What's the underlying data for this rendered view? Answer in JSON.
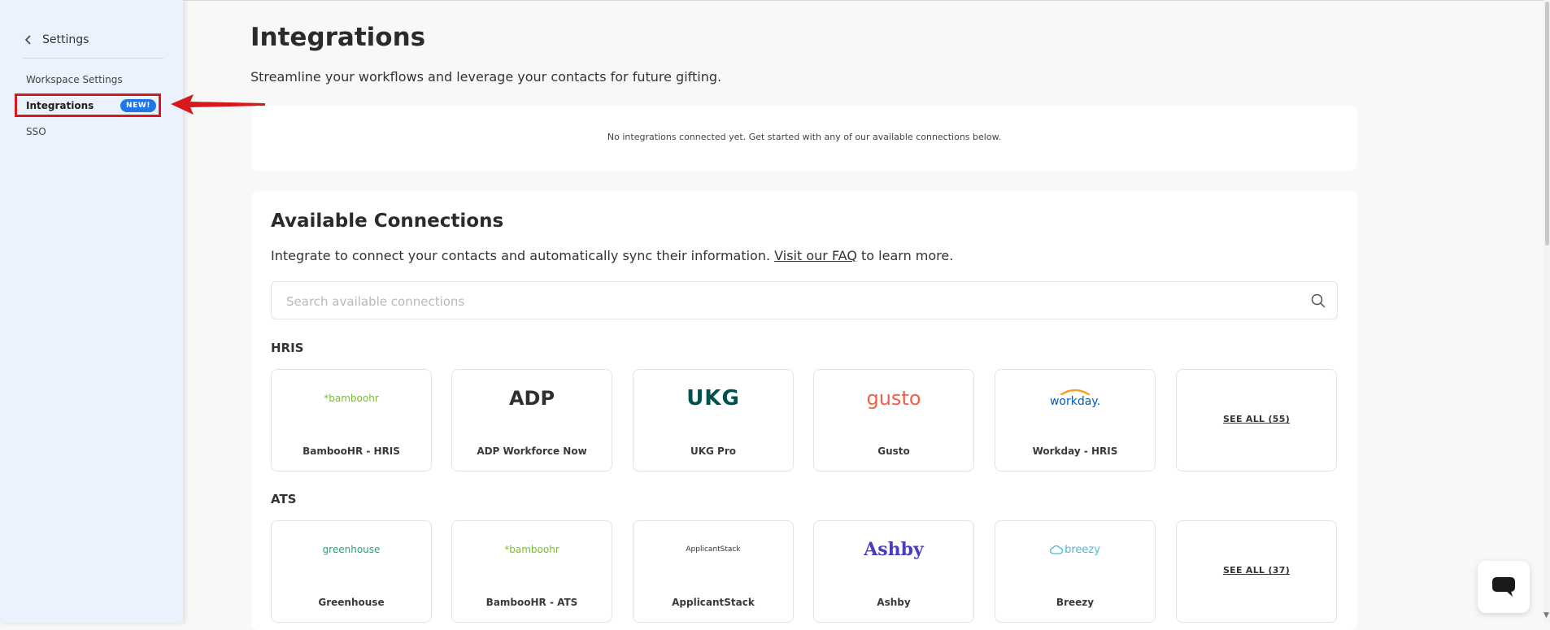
{
  "sidebar": {
    "back_label": "Settings",
    "items": [
      {
        "label": "Workspace Settings"
      },
      {
        "label": "Integrations",
        "badge": "NEW!"
      },
      {
        "label": "SSO"
      }
    ]
  },
  "header": {
    "title": "Integrations",
    "subtitle": "Streamline your workflows and leverage your contacts for future gifting."
  },
  "empty_state": {
    "text": "No integrations connected yet. Get started with any of our available connections below."
  },
  "connections": {
    "title": "Available Connections",
    "desc_before": "Integrate to connect your contacts and automatically sync their information.",
    "faq_link": "Visit our FAQ",
    "desc_after": " to learn more.",
    "search_placeholder": "Search available connections",
    "hris": {
      "label": "HRIS",
      "tiles": [
        {
          "name": "BambooHR - HRIS",
          "logo_text": "*bamboohr",
          "logo_color": "#73c41d"
        },
        {
          "name": "ADP Workforce Now",
          "logo_text": "ADP",
          "logo_color": "#2f2f2f"
        },
        {
          "name": "UKG Pro",
          "logo_text": "UKG",
          "logo_color": "#005151"
        },
        {
          "name": "Gusto",
          "logo_text": "gusto",
          "logo_color": "#f45d48"
        },
        {
          "name": "Workday - HRIS",
          "logo_text": "workday.",
          "logo_color": "#005cb9"
        }
      ],
      "see_all": "SEE ALL (55)"
    },
    "ats": {
      "label": "ATS",
      "tiles": [
        {
          "name": "Greenhouse",
          "logo_text": "greenhouse",
          "logo_color": "#24a47f"
        },
        {
          "name": "BambooHR - ATS",
          "logo_text": "*bamboohr",
          "logo_color": "#73c41d"
        },
        {
          "name": "ApplicantStack",
          "logo_text": "ApplicantStack",
          "logo_color": "#333333"
        },
        {
          "name": "Ashby",
          "logo_text": "Ashby",
          "logo_color": "#4b3bbf"
        },
        {
          "name": "Breezy",
          "logo_text": "breezy",
          "logo_color": "#4fb3d9"
        }
      ],
      "see_all": "SEE ALL (37)"
    }
  },
  "colors": {
    "accent": "#1f76e6",
    "highlight_box": "#d7191c",
    "sidebar_bg": "#eaf3fd"
  },
  "icons": [
    "chevron-left-icon",
    "search-icon",
    "chat-icon",
    "arrow-left-icon"
  ]
}
